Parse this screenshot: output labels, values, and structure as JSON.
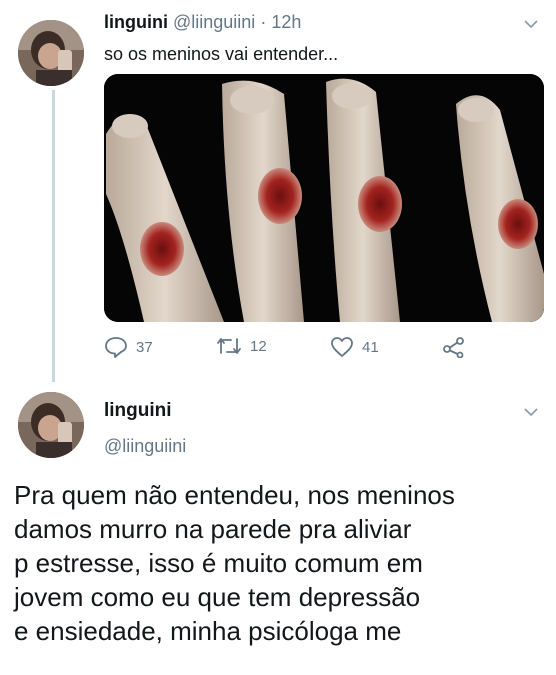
{
  "tweet1": {
    "name": "linguini",
    "handle": "@liinguiini",
    "separator": "·",
    "time": "12h",
    "text": "so os meninos vai entender...",
    "actions": {
      "reply_count": "37",
      "retweet_count": "12",
      "like_count": "41"
    }
  },
  "tweet2": {
    "name": "linguini",
    "handle": "@liinguiini",
    "body_lines": [
      "Pra quem não entendeu, nos meninos",
      "damos murro na parede pra aliviar",
      "p estresse, isso é muito comum em",
      "jovem como eu que tem depressão",
      "e ensiedade, minha psicóloga me"
    ]
  },
  "icons": {
    "reply": "reply-icon",
    "retweet": "retweet-icon",
    "like": "heart-icon",
    "share": "share-icon",
    "menu": "chevron-down-icon"
  },
  "colors": {
    "secondary_text": "#657786",
    "thread_line": "#ccd6dd",
    "photo_background": "#050505"
  }
}
